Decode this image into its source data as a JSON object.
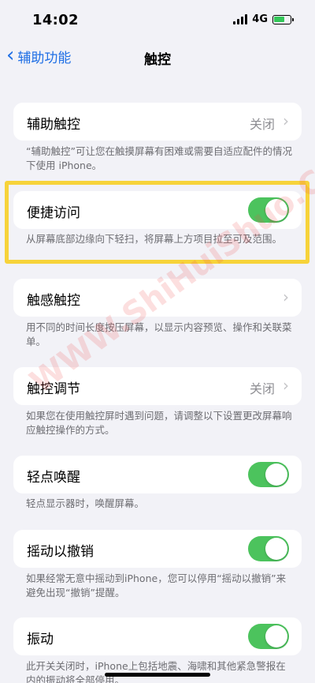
{
  "status": {
    "time": "14:02",
    "network": "4G",
    "battery_level": 0.7
  },
  "nav": {
    "back_label": "辅助功能",
    "title": "触控"
  },
  "settings": [
    {
      "label": "辅助触控",
      "value": "关闭",
      "type": "link",
      "footnote": "“辅助触控”可让您在触摸屏幕有困难或需要自适应配件的情况下使用 iPhone。"
    },
    {
      "label": "便捷访问",
      "type": "toggle",
      "on": true,
      "footnote": "从屏幕底部边缘向下轻扫，将屏幕上方项目拉至可及范围。"
    },
    {
      "label": "触感触控",
      "type": "link",
      "footnote": "用不同的时间长度按压屏幕，以显示内容预览、操作和关联菜单。"
    },
    {
      "label": "触控调节",
      "value": "关闭",
      "type": "link",
      "footnote": "如果您在使用触控屏时遇到问题，请调整以下设置更改屏幕响应触控操作的方式。"
    },
    {
      "label": "轻点唤醒",
      "type": "toggle",
      "on": true,
      "footnote": "轻点显示器时，唤醒屏幕。"
    },
    {
      "label": "摇动以撤销",
      "type": "toggle",
      "on": true,
      "footnote": "如果经常无意中摇动到iPhone，您可以停用“摇动以撤销”来避免出现“撤销”提醒。"
    },
    {
      "label": "振动",
      "type": "toggle",
      "on": true,
      "footnote": "此开关关闭时，iPhone上包括地震、海啸和其他紧急警报在内的振动将全部停用。"
    }
  ],
  "watermark": "WWW.ShiHuiShuo.Com",
  "colors": {
    "accent": "#1f6fe5",
    "toggle_on": "#4cc35d",
    "highlight": "#f7d33a"
  }
}
